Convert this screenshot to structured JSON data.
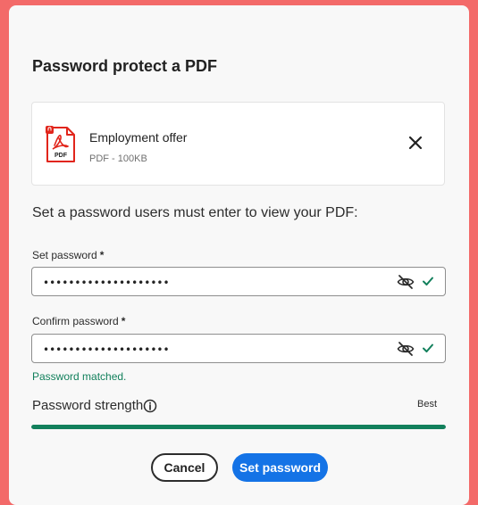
{
  "dialog": {
    "title": "Password protect a PDF"
  },
  "file": {
    "name": "Employment offer",
    "meta": "PDF - 100KB",
    "icon_label": "PDF",
    "icon": "pdf-file-icon",
    "remove_icon": "close-icon"
  },
  "instructions": "Set a password users must enter to view your PDF:",
  "set_password": {
    "label": "Set password",
    "required_mark": "*",
    "value": "••••••••••••••••••••",
    "visibility_icon": "eye-off-icon",
    "status_icon": "checkmark-icon"
  },
  "confirm_password": {
    "label": "Confirm password",
    "required_mark": "*",
    "value": "••••••••••••••••••••",
    "visibility_icon": "eye-off-icon",
    "status_icon": "checkmark-icon"
  },
  "match_message": "Password matched.",
  "strength": {
    "label": "Password strength",
    "info_icon": "info-icon",
    "value": "Best",
    "level": 1.0
  },
  "buttons": {
    "cancel": "Cancel",
    "submit": "Set password"
  },
  "colors": {
    "backdrop": "#f36a69",
    "primary": "#1473e6",
    "success": "#12805c",
    "pdf_red": "#e1251b"
  }
}
